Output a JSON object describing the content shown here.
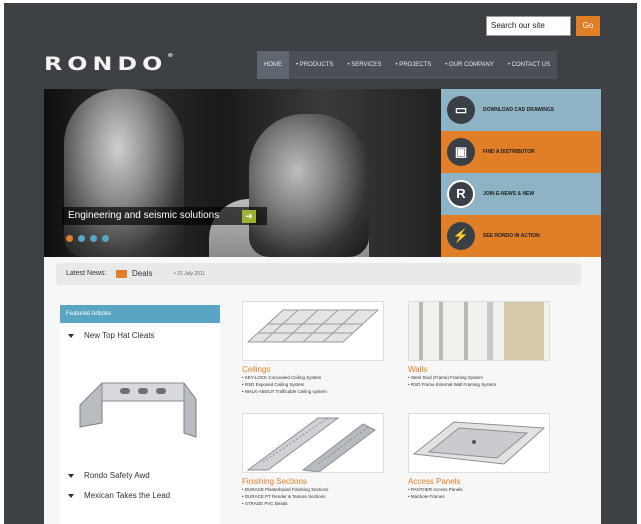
{
  "header": {
    "search_placeholder": "Search our site",
    "go_label": "Go",
    "logo_text": "RONDO"
  },
  "nav": {
    "items": [
      "HOME",
      "• PRODUCTS",
      "• SERVICES",
      "• PROJECTS",
      "• OUR COMPANY",
      "• CONTACT US"
    ]
  },
  "banner": {
    "caption": "Engineering and seismic solutions",
    "arrow": "➔"
  },
  "side_panels": [
    {
      "label": "DOWNLOAD CAD DRAWINGS",
      "icon": "cad-icon",
      "glyph": "▭",
      "color": "#8db3c4"
    },
    {
      "label": "FIND A DISTRIBUTOR",
      "icon": "truck-icon",
      "glyph": "▣",
      "color": "#e07f28"
    },
    {
      "label": "JOIN E-NEWS & NEW",
      "icon": "registered-icon",
      "glyph": "R",
      "color": "#8db3c4"
    },
    {
      "label": "SEE RONDO IN ACTION",
      "icon": "lightning-icon",
      "glyph": "⚡",
      "color": "#e07f28"
    }
  ],
  "news": {
    "label": "Latest News:",
    "title": "Deals",
    "date": "• 21 July 2011"
  },
  "featured": {
    "header": "Featured Articles",
    "items": [
      "New Top Hat Cleats",
      "Rondo Safety Awd",
      "Mexican Takes the Lead"
    ]
  },
  "products": [
    {
      "title": "Ceilings",
      "lines": [
        "• KEY-LOCK Concealed Ceiling System",
        "• RSD Exposed Ceiling System",
        "• WALK-ABOUT Trafficable Ceiling system"
      ]
    },
    {
      "title": "Walls",
      "lines": [
        "• Steel Stud (Frame) Framing System",
        "• RSD Frame External Wall Framing System"
      ]
    },
    {
      "title": "Finishing Sections",
      "lines": [
        "• DURACE Plasterboard Finishing Sections",
        "• DURACE PT Render & Texture Sections",
        "• STRADE PVC Beads"
      ]
    },
    {
      "title": "Access Panels",
      "lines": [
        "• PANTHER Access Panels",
        "• Manhole Frames"
      ]
    }
  ],
  "colors": {
    "accent": "#e07f28",
    "blue": "#5aa4c4",
    "dark": "#3d4045"
  }
}
